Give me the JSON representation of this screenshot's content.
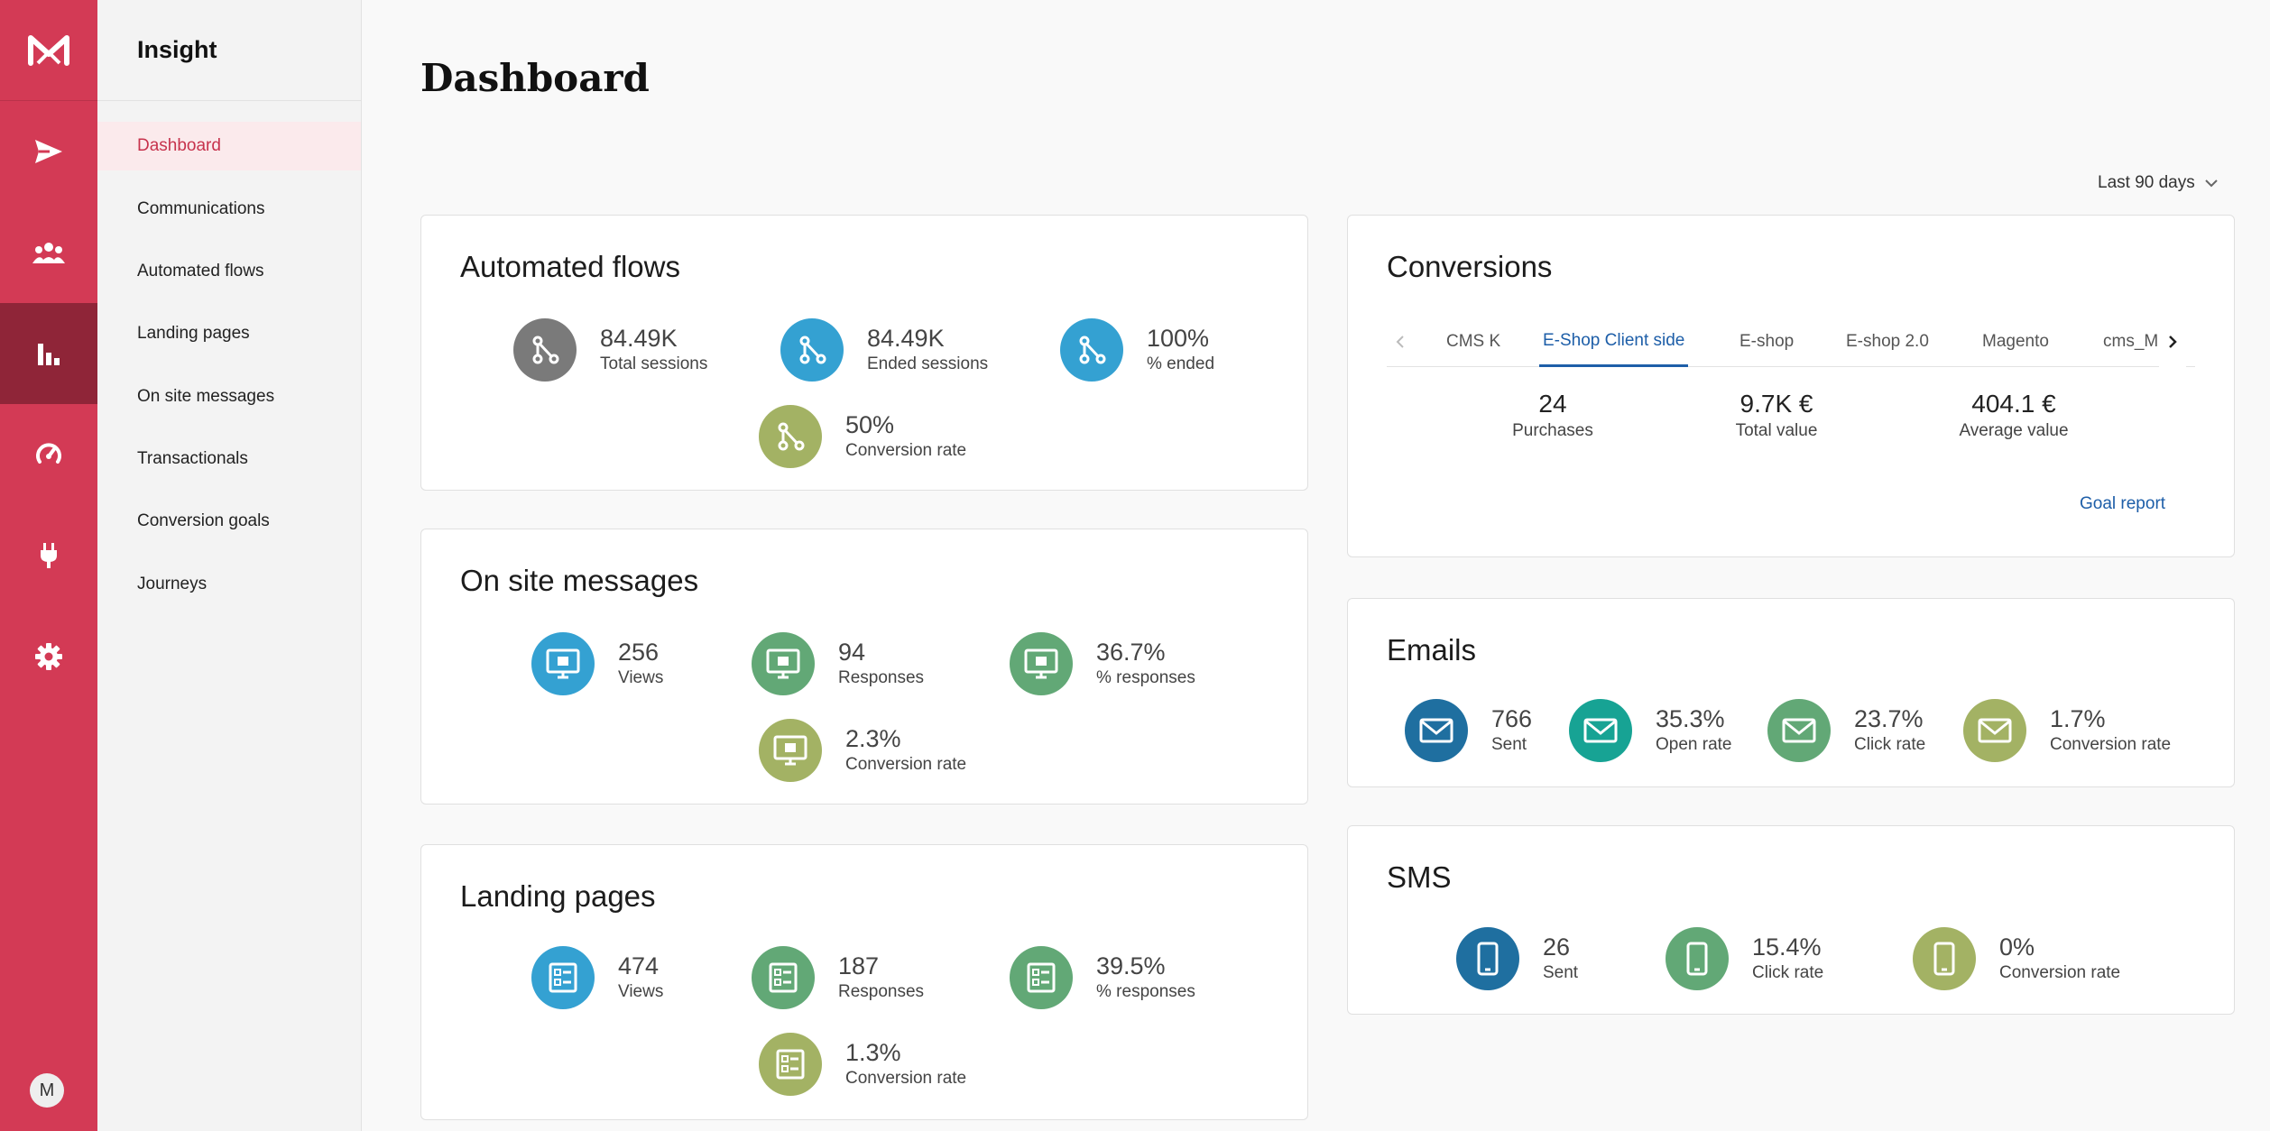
{
  "app": {
    "section_title": "Insight",
    "avatar_initial": "M"
  },
  "rail": {
    "icons": [
      "send-icon",
      "people-icon",
      "bar-chart-icon",
      "gauge-icon",
      "plug-icon",
      "gear-icon"
    ],
    "active": "bar-chart-icon"
  },
  "sidebar": {
    "items": [
      {
        "label": "Dashboard",
        "active": true
      },
      {
        "label": "Communications"
      },
      {
        "label": "Automated flows"
      },
      {
        "label": "Landing pages"
      },
      {
        "label": "On site messages"
      },
      {
        "label": "Transactionals"
      },
      {
        "label": "Conversion goals"
      },
      {
        "label": "Journeys"
      }
    ]
  },
  "main": {
    "title": "Dashboard",
    "range": "Last 90 days"
  },
  "automated_flows": {
    "title": "Automated flows",
    "stats": [
      {
        "value": "84.49K",
        "label": "Total sessions",
        "color": "#7a7a7a",
        "icon": "flow-icon"
      },
      {
        "value": "84.49K",
        "label": "Ended sessions",
        "color": "#34a1d2",
        "icon": "flow-icon"
      },
      {
        "value": "100%",
        "label": "% ended",
        "color": "#34a1d2",
        "icon": "flow-icon"
      },
      {
        "value": "50%",
        "label": "Conversion rate",
        "color": "#a3b264",
        "icon": "flow-icon"
      }
    ]
  },
  "on_site_messages": {
    "title": "On site messages",
    "stats": [
      {
        "value": "256",
        "label": "Views",
        "color": "#34a1d2",
        "icon": "monitor-icon"
      },
      {
        "value": "94",
        "label": "Responses",
        "color": "#62a876",
        "icon": "monitor-icon"
      },
      {
        "value": "36.7%",
        "label": "% responses",
        "color": "#62a876",
        "icon": "monitor-icon"
      },
      {
        "value": "2.3%",
        "label": "Conversion rate",
        "color": "#a3b264",
        "icon": "monitor-icon"
      }
    ]
  },
  "landing_pages": {
    "title": "Landing pages",
    "stats": [
      {
        "value": "474",
        "label": "Views",
        "color": "#34a1d2",
        "icon": "form-icon"
      },
      {
        "value": "187",
        "label": "Responses",
        "color": "#62a876",
        "icon": "form-icon"
      },
      {
        "value": "39.5%",
        "label": "% responses",
        "color": "#62a876",
        "icon": "form-icon"
      },
      {
        "value": "1.3%",
        "label": "Conversion rate",
        "color": "#a3b264",
        "icon": "form-icon"
      }
    ]
  },
  "conversions": {
    "title": "Conversions",
    "tabs": [
      "CMS K",
      "E-Shop Client side",
      "E-shop",
      "E-shop 2.0",
      "Magento",
      "cms_M"
    ],
    "active_tab": "E-Shop Client side",
    "kpis": [
      {
        "value": "24",
        "label": "Purchases"
      },
      {
        "value": "9.7K €",
        "label": "Total value"
      },
      {
        "value": "404.1 €",
        "label": "Average value"
      }
    ],
    "link": "Goal report"
  },
  "emails": {
    "title": "Emails",
    "stats": [
      {
        "value": "766",
        "label": "Sent",
        "color": "#1f6fa0",
        "icon": "mail-icon"
      },
      {
        "value": "35.3%",
        "label": "Open rate",
        "color": "#17a394",
        "icon": "mail-icon"
      },
      {
        "value": "23.7%",
        "label": "Click rate",
        "color": "#62a876",
        "icon": "mail-icon"
      },
      {
        "value": "1.7%",
        "label": "Conversion rate",
        "color": "#a3b264",
        "icon": "mail-icon"
      }
    ]
  },
  "sms": {
    "title": "SMS",
    "stats": [
      {
        "value": "26",
        "label": "Sent",
        "color": "#1f6fa0",
        "icon": "phone-icon"
      },
      {
        "value": "15.4%",
        "label": "Click rate",
        "color": "#62a876",
        "icon": "phone-icon"
      },
      {
        "value": "0%",
        "label": "Conversion rate",
        "color": "#a3b264",
        "icon": "phone-icon"
      }
    ]
  }
}
